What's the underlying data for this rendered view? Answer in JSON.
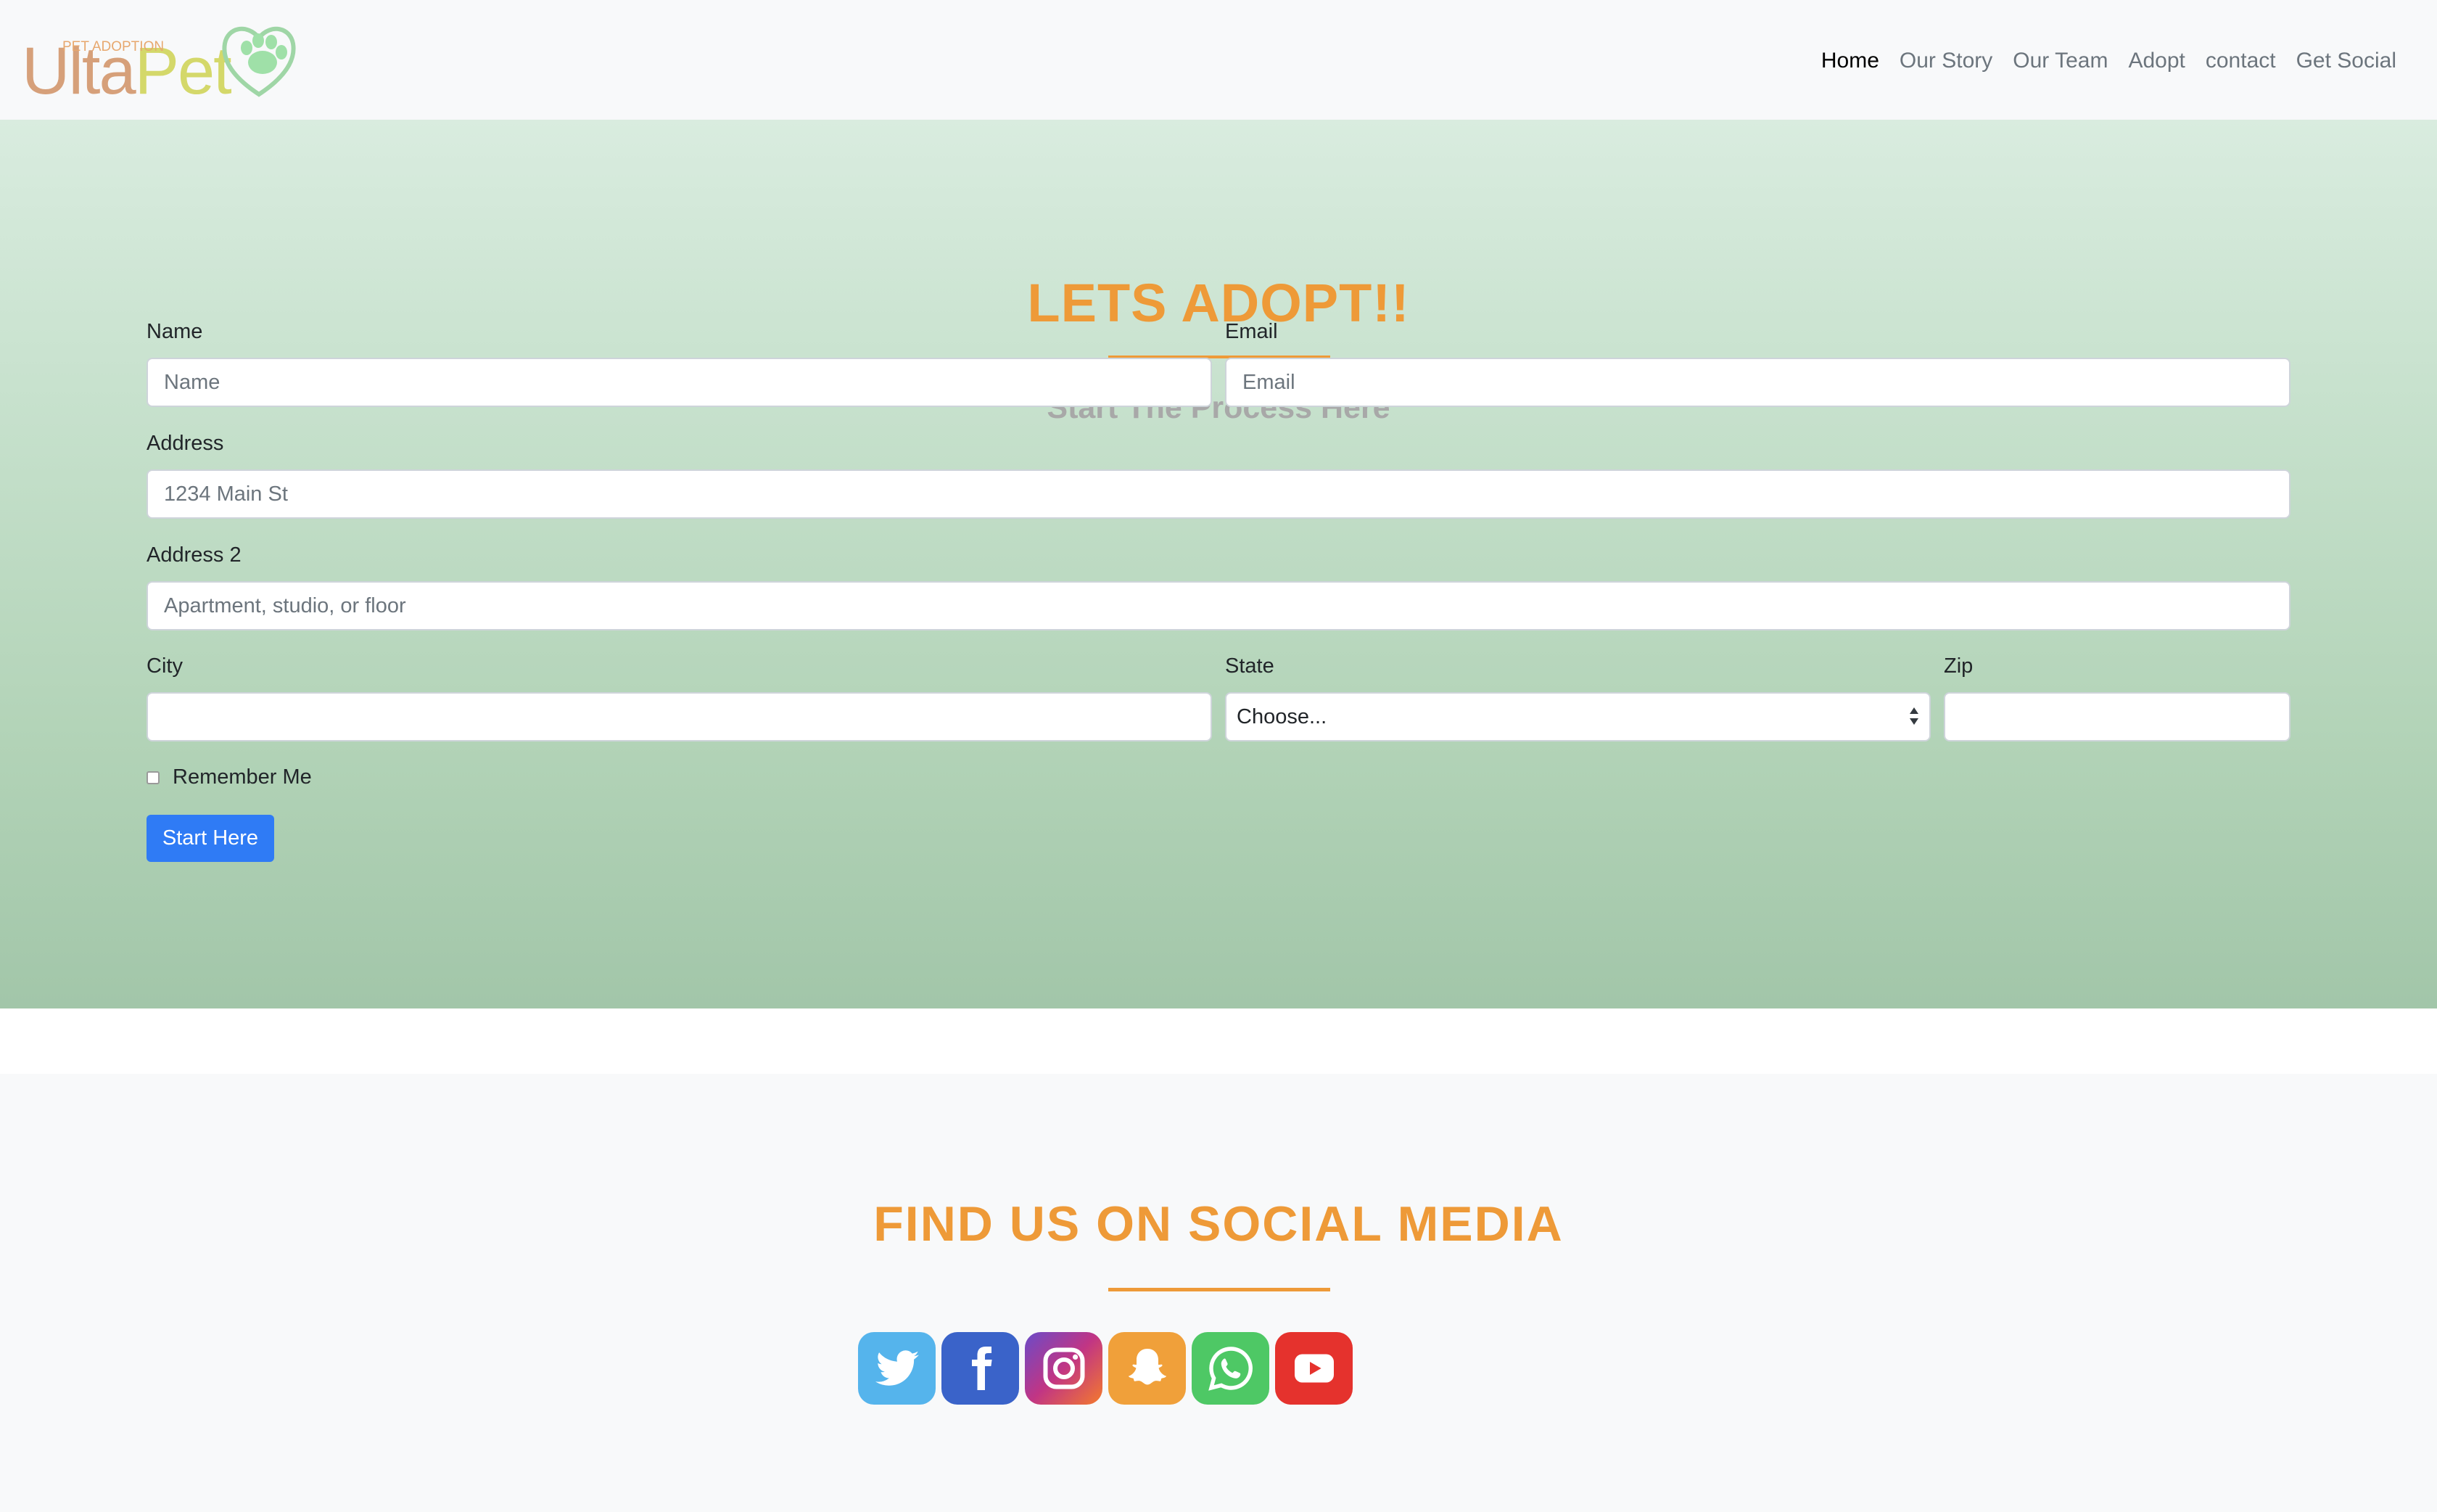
{
  "logo": {
    "main_left": "Ulta",
    "main_right": "Pet",
    "tagline": "PET ADOPTION",
    "icon": "heart-paw-icon"
  },
  "nav": {
    "items": [
      {
        "label": "Home",
        "active": true
      },
      {
        "label": "Our Story",
        "active": false
      },
      {
        "label": "Our Team",
        "active": false
      },
      {
        "label": "Adopt",
        "active": false
      },
      {
        "label": "contact",
        "active": false
      },
      {
        "label": "Get Social",
        "active": false
      }
    ]
  },
  "hero": {
    "title": "LETS ADOPT!!",
    "subtitle": "Start The Process Here"
  },
  "form": {
    "name": {
      "label": "Name",
      "placeholder": "Name",
      "value": ""
    },
    "email": {
      "label": "Email",
      "placeholder": "Email",
      "value": ""
    },
    "address": {
      "label": "Address",
      "placeholder": "1234 Main St",
      "value": ""
    },
    "address2": {
      "label": "Address 2",
      "placeholder": "Apartment, studio, or floor",
      "value": ""
    },
    "city": {
      "label": "City",
      "placeholder": "",
      "value": ""
    },
    "state": {
      "label": "State",
      "selected": "Choose..."
    },
    "zip": {
      "label": "Zip",
      "placeholder": "",
      "value": ""
    },
    "remember": {
      "label": "Remember Me",
      "checked": false
    },
    "submit_label": "Start Here"
  },
  "social": {
    "title": "FIND US ON SOCIAL MEDIA",
    "icons": [
      {
        "name": "twitter-icon",
        "color": "#55b4ec"
      },
      {
        "name": "facebook-icon",
        "color": "#3a63c9"
      },
      {
        "name": "instagram-icon",
        "color": "#c13584"
      },
      {
        "name": "snapchat-icon",
        "color": "#f0a03a"
      },
      {
        "name": "whatsapp-icon",
        "color": "#4ec865"
      },
      {
        "name": "youtube-icon",
        "color": "#e5322d"
      }
    ]
  },
  "colors": {
    "accent": "#ee9a38",
    "button": "#2f7bf5",
    "subtitle": "#a8a8a8"
  }
}
